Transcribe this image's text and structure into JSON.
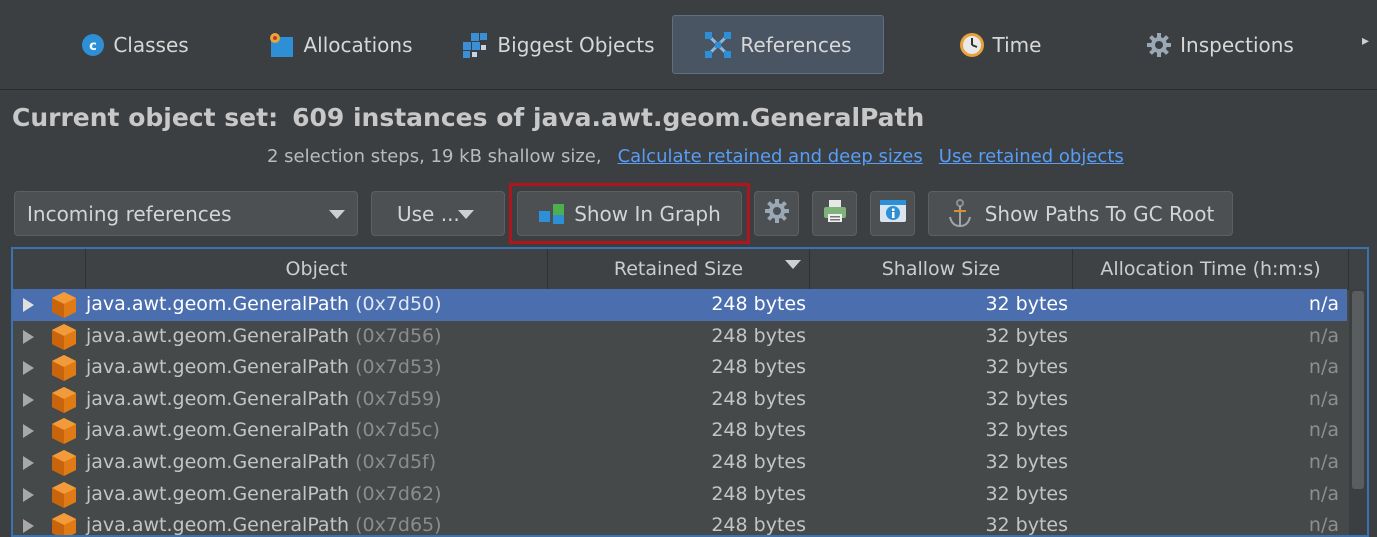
{
  "tabs": [
    {
      "label": "Classes",
      "icon": "classes-icon",
      "active": false
    },
    {
      "label": "Allocations",
      "icon": "allocations-icon",
      "active": false
    },
    {
      "label": "Biggest Objects",
      "icon": "biggest-objects-icon",
      "active": false
    },
    {
      "label": "References",
      "icon": "references-icon",
      "active": true
    },
    {
      "label": "Time",
      "icon": "clock-icon",
      "active": false
    },
    {
      "label": "Inspections",
      "icon": "gear-icon",
      "active": false
    }
  ],
  "header": {
    "title_label": "Current object set:",
    "title_value": "609 instances of java.awt.geom.GeneralPath",
    "summary": "2 selection steps, 19 kB shallow size,",
    "link_calculate": "Calculate retained and deep sizes",
    "link_use_retained": "Use retained objects"
  },
  "toolbar": {
    "reference_mode": "Incoming references",
    "use_label": "Use ...",
    "show_in_graph": "Show In Graph",
    "show_paths": "Show Paths To GC Root"
  },
  "table": {
    "columns": [
      "Object",
      "Retained Size",
      "Shallow Size",
      "Allocation Time (h:m:s)"
    ],
    "rows": [
      {
        "cls": "java.awt.geom.GeneralPath",
        "addr": "(0x7d50)",
        "retained": "248 bytes",
        "shallow": "32 bytes",
        "alloc": "n/a",
        "selected": true
      },
      {
        "cls": "java.awt.geom.GeneralPath",
        "addr": "(0x7d56)",
        "retained": "248 bytes",
        "shallow": "32 bytes",
        "alloc": "n/a",
        "selected": false
      },
      {
        "cls": "java.awt.geom.GeneralPath",
        "addr": "(0x7d53)",
        "retained": "248 bytes",
        "shallow": "32 bytes",
        "alloc": "n/a",
        "selected": false
      },
      {
        "cls": "java.awt.geom.GeneralPath",
        "addr": "(0x7d59)",
        "retained": "248 bytes",
        "shallow": "32 bytes",
        "alloc": "n/a",
        "selected": false
      },
      {
        "cls": "java.awt.geom.GeneralPath",
        "addr": "(0x7d5c)",
        "retained": "248 bytes",
        "shallow": "32 bytes",
        "alloc": "n/a",
        "selected": false
      },
      {
        "cls": "java.awt.geom.GeneralPath",
        "addr": "(0x7d5f)",
        "retained": "248 bytes",
        "shallow": "32 bytes",
        "alloc": "n/a",
        "selected": false
      },
      {
        "cls": "java.awt.geom.GeneralPath",
        "addr": "(0x7d62)",
        "retained": "248 bytes",
        "shallow": "32 bytes",
        "alloc": "n/a",
        "selected": false
      },
      {
        "cls": "java.awt.geom.GeneralPath",
        "addr": "(0x7d65)",
        "retained": "248 bytes",
        "shallow": "32 bytes",
        "alloc": "n/a",
        "selected": false
      }
    ]
  },
  "colors": {
    "background": "#3c3f41",
    "selection": "#4b6eaf",
    "link": "#589df6",
    "highlight_frame": "#b0151c",
    "object_cube": "#e07a14"
  }
}
